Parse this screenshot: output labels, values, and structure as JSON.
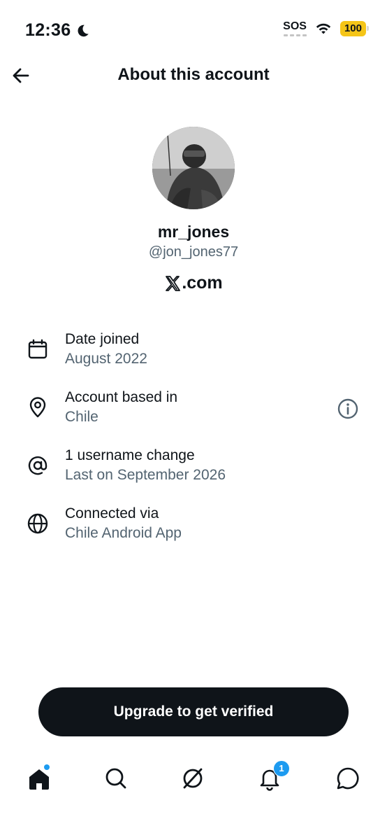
{
  "status_bar": {
    "time": "12:36",
    "sos": "SOS",
    "battery": "100"
  },
  "header": {
    "title": "About this account"
  },
  "profile": {
    "display_name": "mr_jones",
    "handle": "@jon_jones77",
    "site": ".com"
  },
  "info": [
    {
      "title": "Date joined",
      "value": "August 2022",
      "icon": "calendar-icon"
    },
    {
      "title": "Account based in",
      "value": "Chile",
      "icon": "location-pin-icon"
    },
    {
      "title": "1 username change",
      "value": "Last on September 2026",
      "icon": "at-sign-icon"
    },
    {
      "title": "Connected via",
      "value": "Chile Android App",
      "icon": "globe-icon"
    }
  ],
  "upgrade": {
    "label": "Upgrade to get verified"
  },
  "nav": {
    "notifications_badge": "1",
    "accent": "#1d9bf0"
  }
}
